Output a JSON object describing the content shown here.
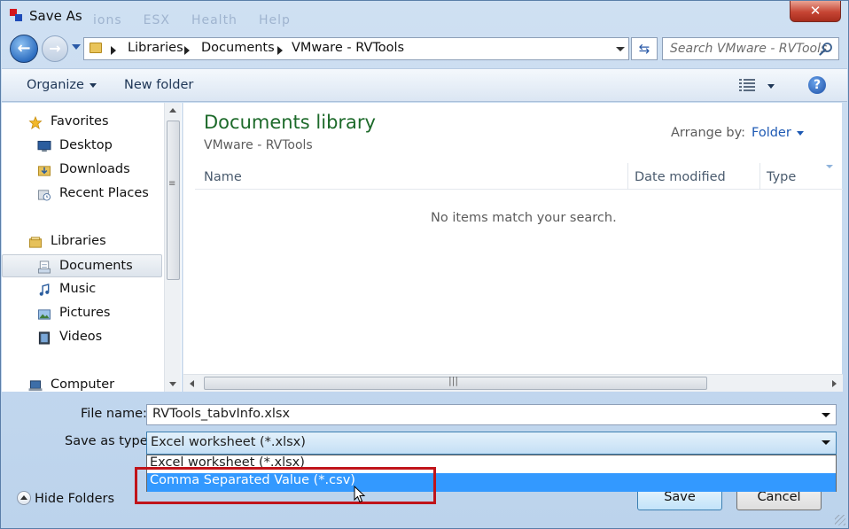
{
  "window": {
    "title": "Save As",
    "background_menu": [
      "ions",
      "ESX",
      "Health",
      "Help"
    ]
  },
  "address": {
    "breadcrumbs": [
      "Libraries",
      "Documents",
      "VMware - RVTools"
    ],
    "search_placeholder": "Search VMware - RVTools"
  },
  "toolbar": {
    "organize": "Organize",
    "new_folder": "New folder"
  },
  "nav": {
    "favorites": "Favorites",
    "desktop": "Desktop",
    "downloads": "Downloads",
    "recent_places": "Recent Places",
    "libraries": "Libraries",
    "documents": "Documents",
    "music": "Music",
    "pictures": "Pictures",
    "videos": "Videos",
    "computer": "Computer"
  },
  "content": {
    "library_title": "Documents library",
    "library_subtitle": "VMware - RVTools",
    "arrange_by_label": "Arrange by:",
    "arrange_by_value": "Folder",
    "columns": [
      "Name",
      "Date modified",
      "Type"
    ],
    "empty_message": "No items match your search."
  },
  "form": {
    "file_name_label": "File name:",
    "file_name_value": "RVTools_tabvInfo.xlsx",
    "save_type_label": "Save as type:",
    "save_type_value": "Excel worksheet (*.xlsx)",
    "save_type_options": [
      "Excel worksheet (*.xlsx)",
      "Comma Separated Value (*.csv)"
    ],
    "highlighted_option_index": 1
  },
  "footer": {
    "hide_folders": "Hide Folders",
    "save": "Save",
    "cancel": "Cancel"
  },
  "colors": {
    "library_title": "#1d6a2a",
    "highlight": "#3399ff",
    "annotation_box": "#c0141a"
  }
}
